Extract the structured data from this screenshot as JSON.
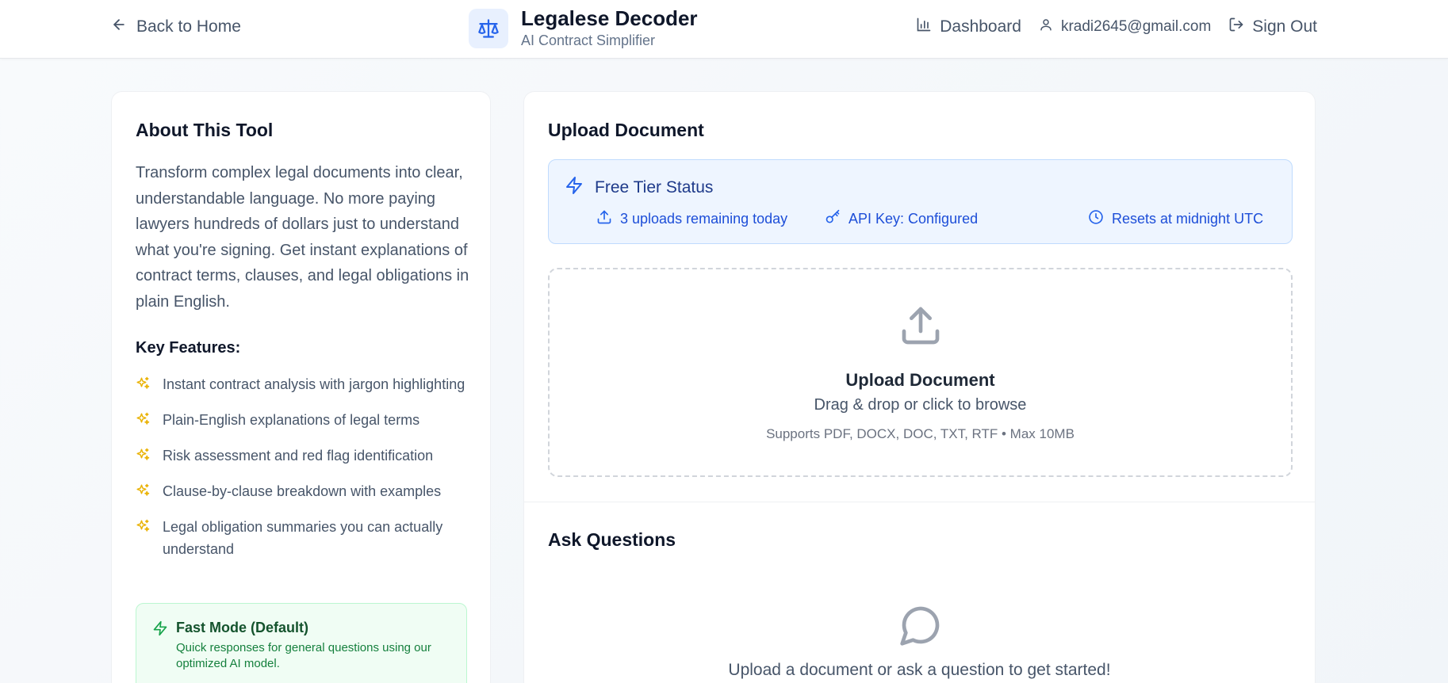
{
  "header": {
    "back_label": "Back to Home",
    "brand_title": "Legalese Decoder",
    "brand_subtitle": "AI Contract Simplifier",
    "dashboard_label": "Dashboard",
    "user_email": "kradi2645@gmail.com",
    "signout_label": "Sign Out"
  },
  "about": {
    "title": "About This Tool",
    "description": "Transform complex legal documents into clear, understandable language. No more paying lawyers hundreds of dollars just to understand what you're signing. Get instant explanations of contract terms, clauses, and legal obligations in plain English.",
    "features_title": "Key Features:",
    "features": [
      "Instant contract analysis with jargon highlighting",
      "Plain-English explanations of legal terms",
      "Risk assessment and red flag identification",
      "Clause-by-clause breakdown with examples",
      "Legal obligation summaries you can actually understand"
    ],
    "fast_mode_title": "Fast Mode (Default)",
    "fast_mode_desc": "Quick responses for general questions using our optimized AI model."
  },
  "upload": {
    "title": "Upload Document",
    "tier_title": "Free Tier Status",
    "uploads_remaining": "3 uploads remaining today",
    "api_key_status": "API Key: Configured",
    "reset_info": "Resets at midnight UTC",
    "dropzone_title": "Upload Document",
    "dropzone_sub": "Drag & drop or click to browse",
    "dropzone_formats": "Supports PDF, DOCX, DOC, TXT, RTF • Max 10MB"
  },
  "ask": {
    "title": "Ask Questions",
    "empty_text": "Upload a document or ask a question to get started!"
  },
  "colors": {
    "accent_blue": "#2563eb",
    "spark_yellow": "#eab308",
    "green": "#16a34a"
  }
}
